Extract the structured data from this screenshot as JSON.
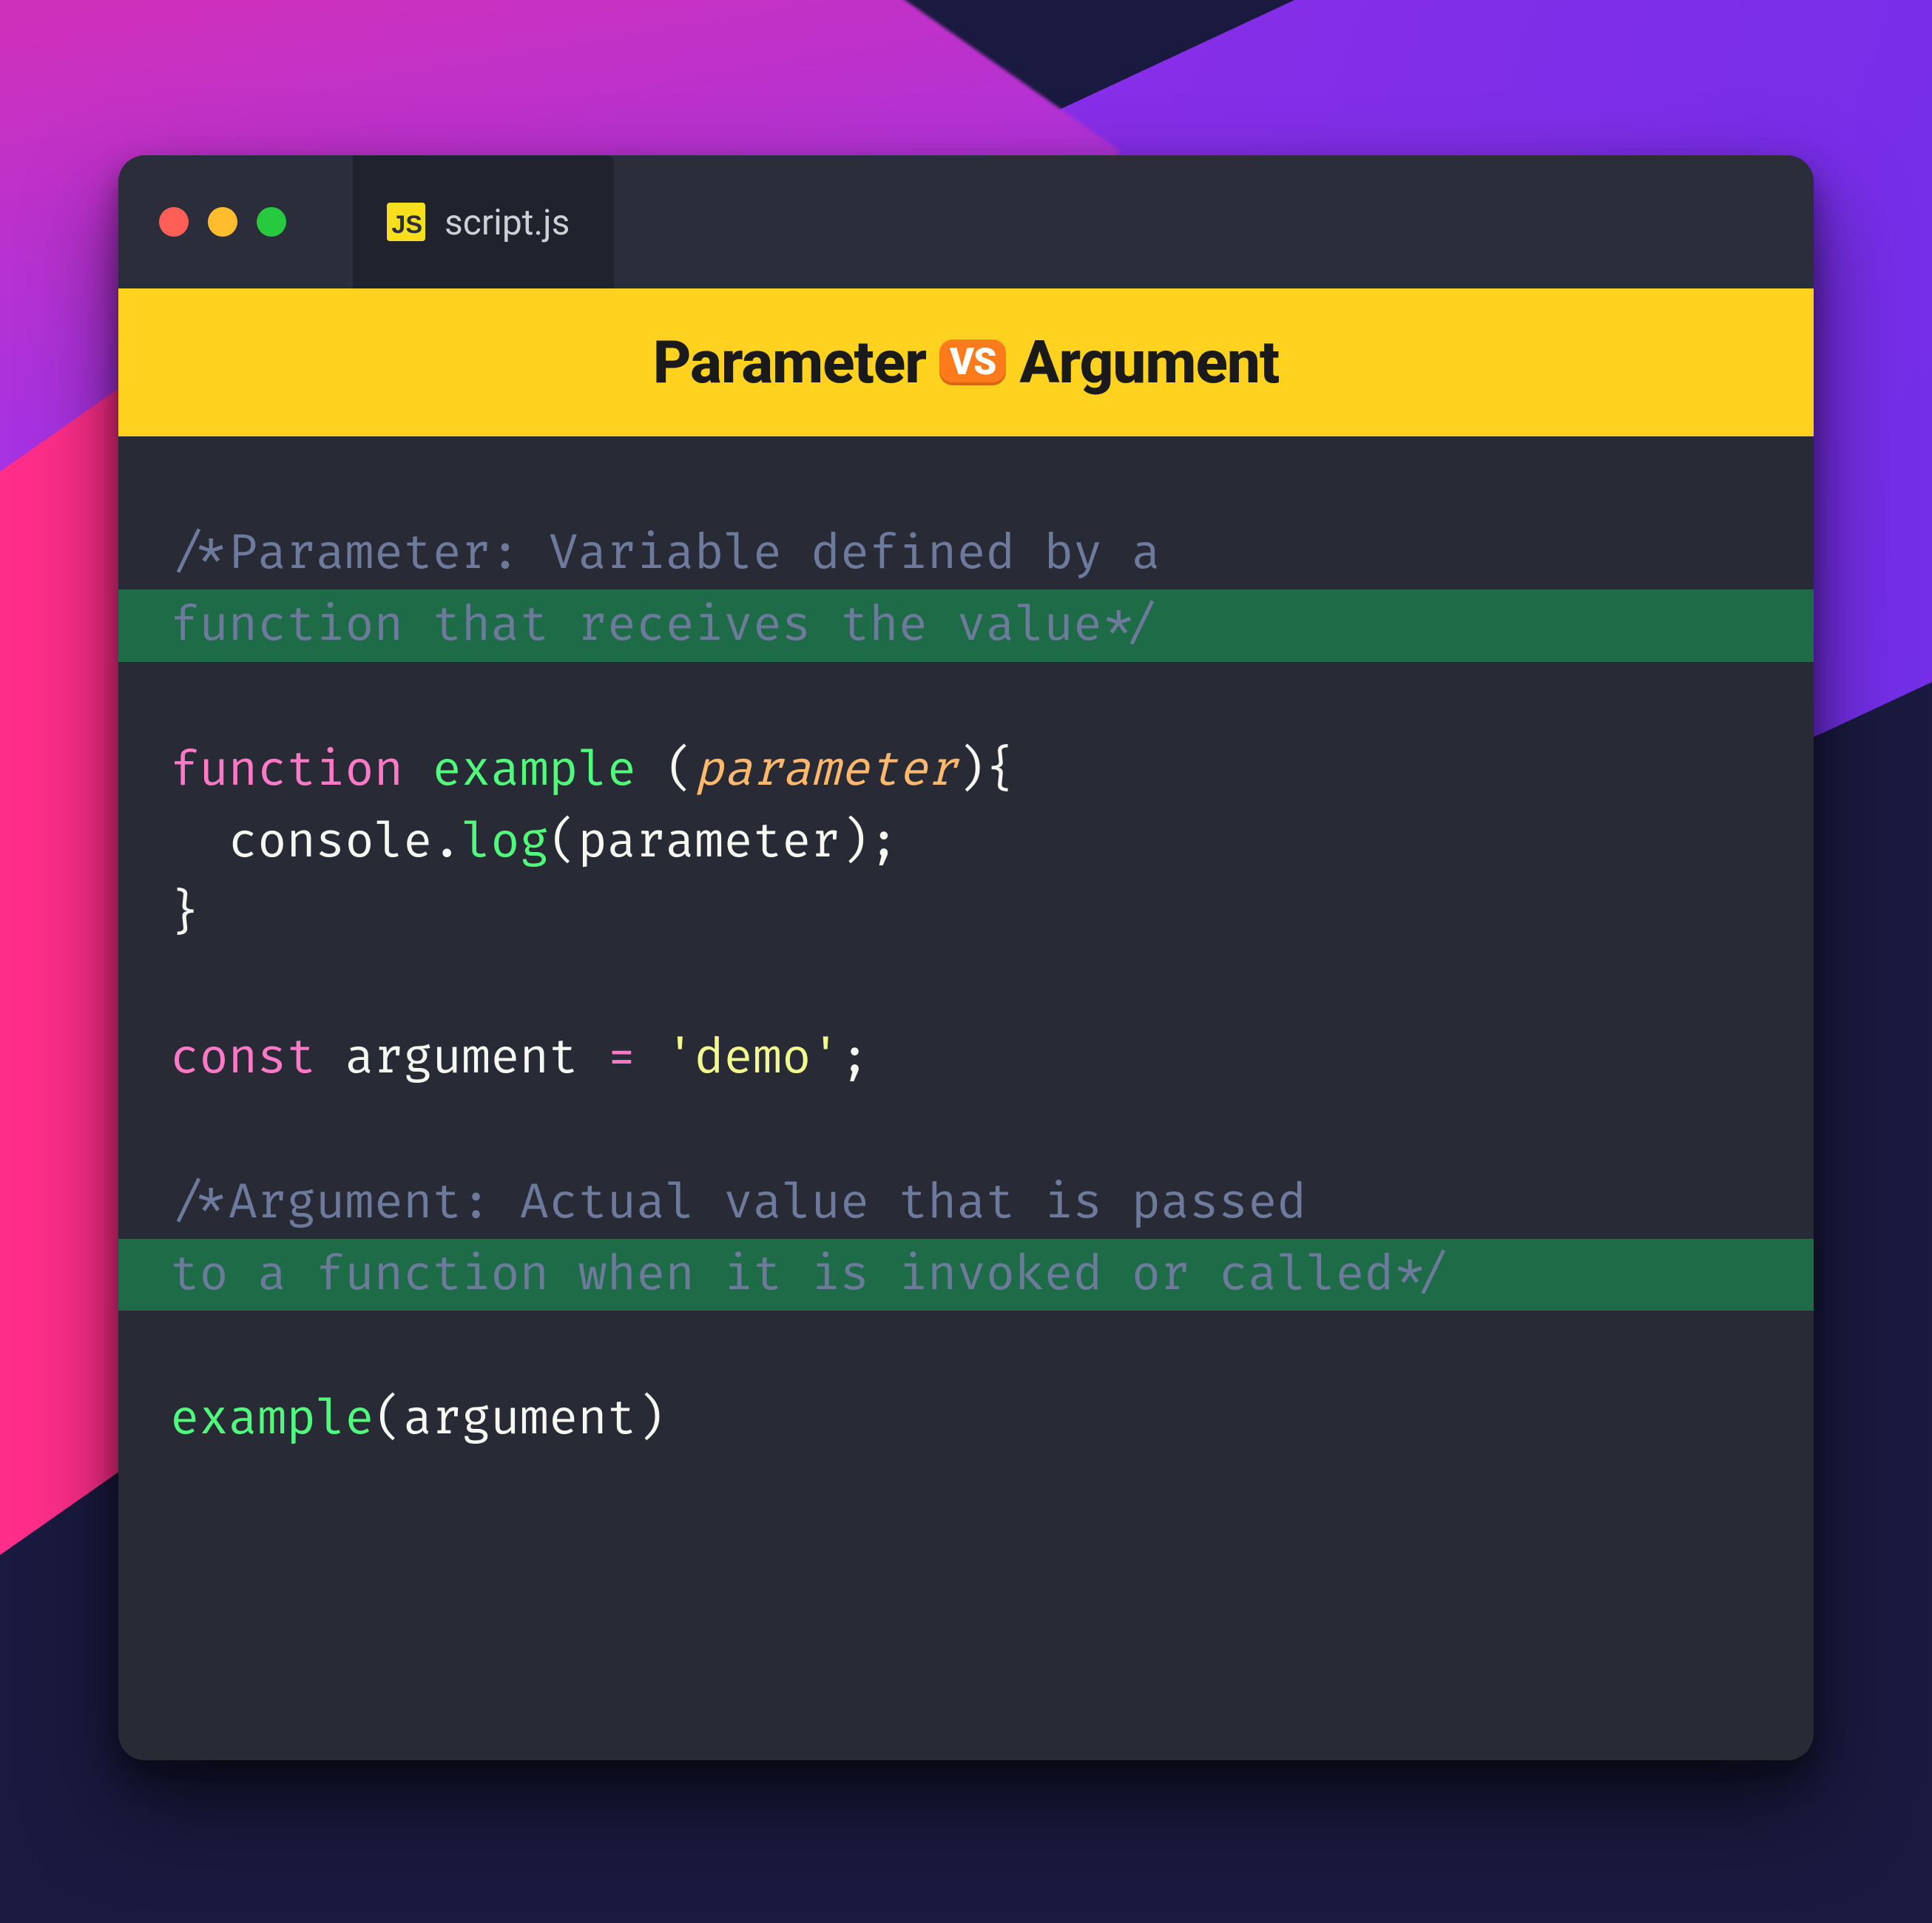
{
  "tab": {
    "badge": "JS",
    "filename": "script.js"
  },
  "banner": {
    "left": "Parameter",
    "vs": "VS",
    "right": "Argument"
  },
  "code": {
    "comment_param_1": "/*Parameter: Variable defined by a",
    "comment_param_2": "function that receives the value*/",
    "kw_function": "function",
    "fn_example": "example",
    "param_name": "parameter",
    "open_brace": "{",
    "console_obj": "console",
    "dot": ".",
    "log_fn": "log",
    "log_arg": "parameter",
    "close_brace": "}",
    "kw_const": "const",
    "var_argument": "argument",
    "eq": "=",
    "str_demo": "'demo'",
    "semi": ";",
    "comment_arg_1": "/*Argument: Actual value that is passed",
    "comment_arg_2": "to a function when it is invoked or called*/",
    "call_fn": "example",
    "call_arg": "argument",
    "paren_open": "(",
    "paren_close": ")",
    "space": " ",
    "indent": "  "
  }
}
